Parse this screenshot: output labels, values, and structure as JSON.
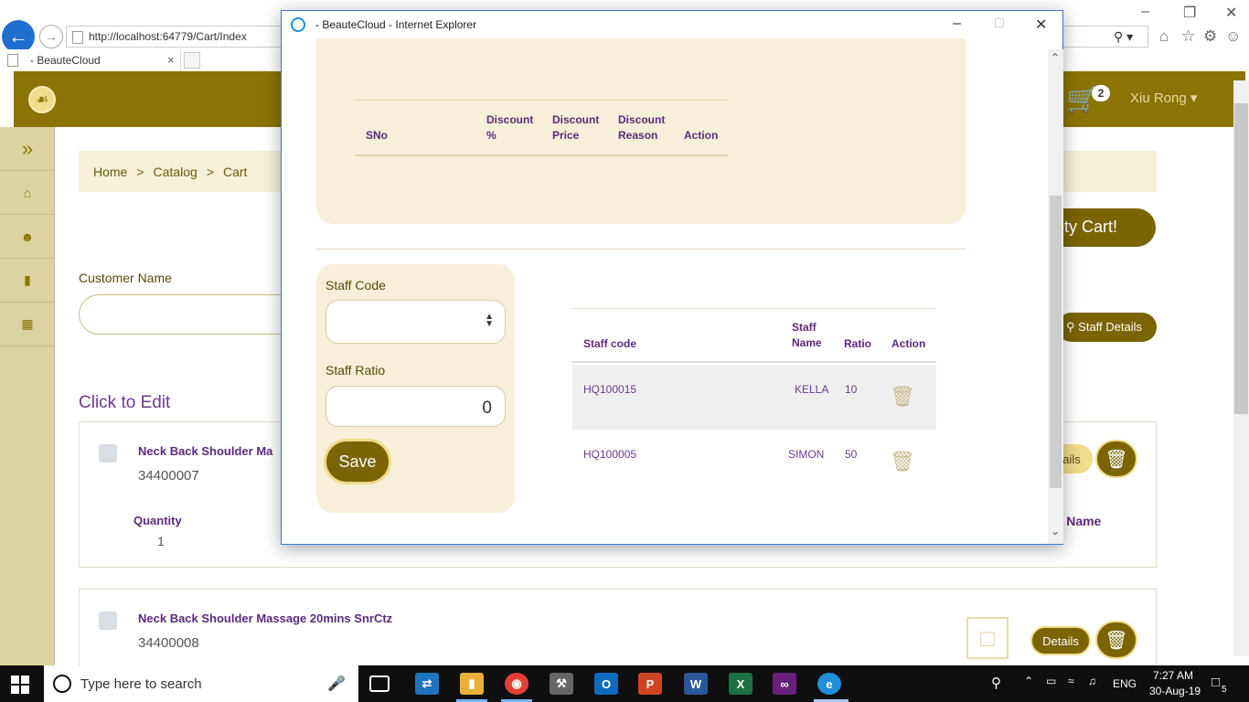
{
  "browser": {
    "url": "http://localhost:64779/Cart/Index",
    "tab_title": "- BeauteCloud",
    "tab_close": "×"
  },
  "app": {
    "cart_count": "2",
    "user_name": "Xiu Rong",
    "breadcrumb": [
      "Home",
      "Catalog",
      "Cart"
    ],
    "breadcrumb_sep": ">",
    "empty_cart_label": "pty Cart!",
    "customer_name_label": "Customer Name",
    "staff_details_label": "Staff Details",
    "click_to_edit": "Click to Edit",
    "items": [
      {
        "name": "Neck Back Shoulder Ma",
        "code": "34400007",
        "quantity_label": "Quantity",
        "quantity": "1",
        "details_label": "ails",
        "staff_name_label": "ff Name"
      },
      {
        "name": "Neck Back Shoulder Massage 20mins SnrCtz",
        "code": "34400008",
        "details_label": "Details"
      }
    ]
  },
  "modal": {
    "title": "- BeauteCloud - Internet Explorer",
    "discount_headers": {
      "sno": "SNo",
      "disc_pct": "Discount %",
      "disc_price": "Discount Price",
      "disc_reason": "Discount Reason",
      "action": "Action"
    },
    "staff_code_label": "Staff Code",
    "staff_ratio_label": "Staff Ratio",
    "staff_ratio_value": "0",
    "save_label": "Save",
    "staff_headers": {
      "code": "Staff code",
      "name": "Staff Name",
      "ratio": "Ratio",
      "action": "Action"
    },
    "staff_rows": [
      {
        "code": "HQ100015",
        "name": "KELLA",
        "ratio": "10"
      },
      {
        "code": "HQ100005",
        "name": "SIMON",
        "ratio": "50"
      }
    ]
  },
  "taskbar": {
    "search_placeholder": "Type here to search",
    "lang": "ENG",
    "time": "7:27 AM",
    "date": "30-Aug-19",
    "notif_count": "5"
  }
}
